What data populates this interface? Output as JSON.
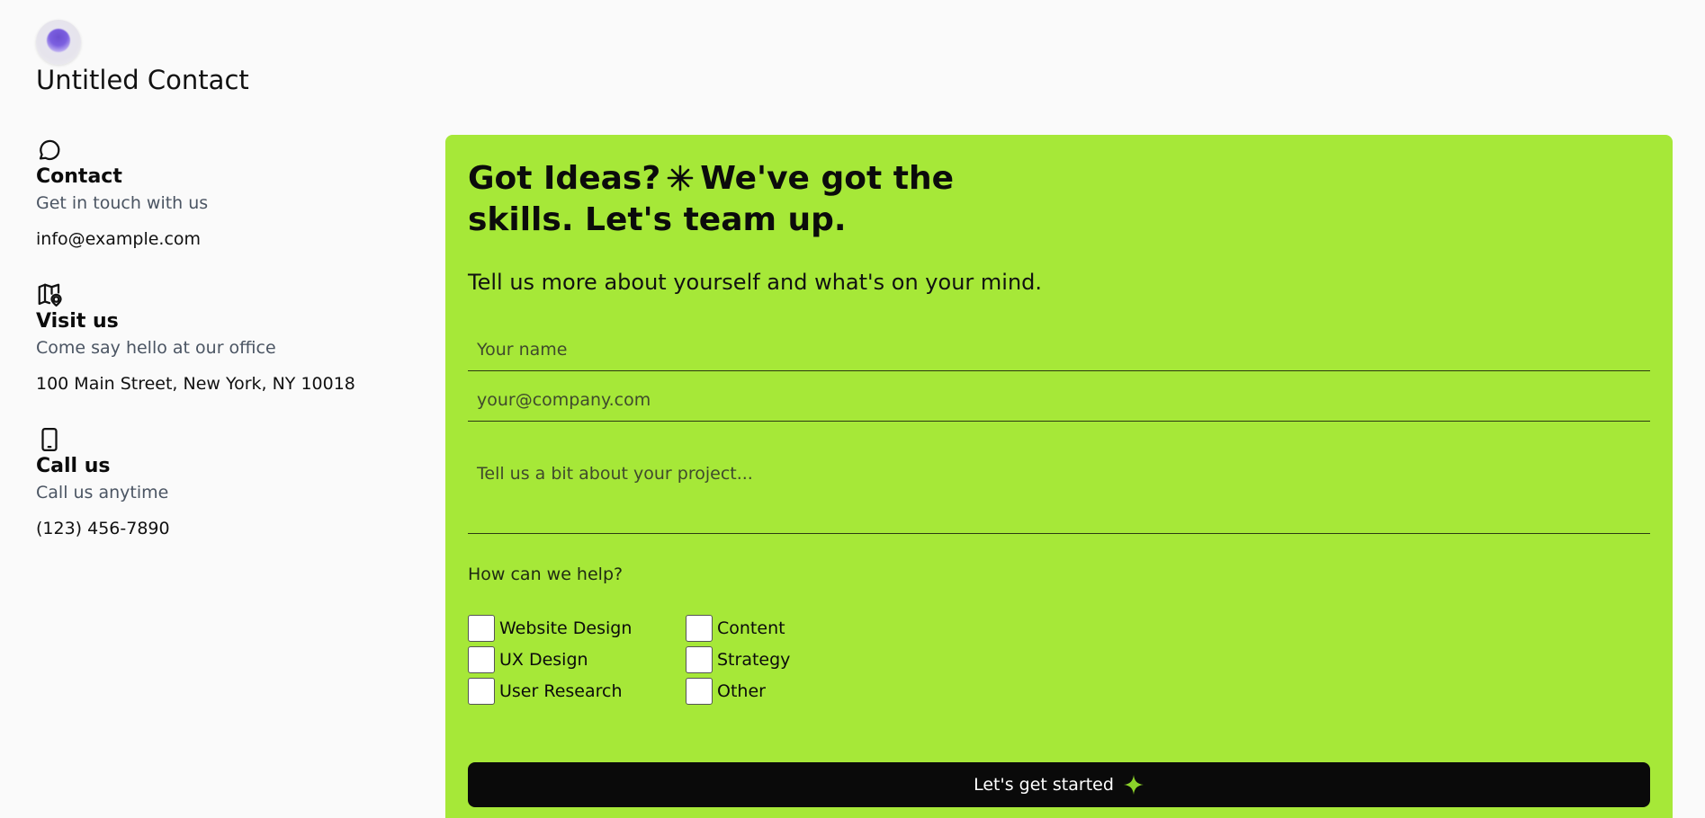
{
  "brand": {
    "title": "Untitled Contact",
    "logo_icon": "purple-orb-logo"
  },
  "contact_info": [
    {
      "icon": "chat-bubble-icon",
      "title": "Contact",
      "subtitle": "Get in touch with us",
      "value": "info@example.com"
    },
    {
      "icon": "map-pin-icon",
      "title": "Visit us",
      "subtitle": "Come say hello at our office",
      "value": "100 Main Street, New York, NY 10018"
    },
    {
      "icon": "phone-icon",
      "title": "Call us",
      "subtitle": "Call us anytime",
      "value": "(123) 456-7890"
    }
  ],
  "form": {
    "headline_part1": "Got Ideas?",
    "headline_part2": "We've got the skills. Let's team up.",
    "lead": "Tell us more about yourself and what's on your mind.",
    "name_placeholder": "Your name",
    "email_placeholder": "your@company.com",
    "message_placeholder": "Tell us a bit about your project...",
    "help_label": "How can we help?",
    "options": [
      "Website Design",
      "Content",
      "UX Design",
      "Strategy",
      "User Research",
      "Other"
    ],
    "submit_label": "Let's get started"
  },
  "colors": {
    "page_background": "#fafafa",
    "panel_background": "#a6e838",
    "button_background": "#0a0a0a",
    "button_text": "#ffffff",
    "accent_spark": "#8bd12a",
    "logo_purple": "#6c4fd1"
  }
}
